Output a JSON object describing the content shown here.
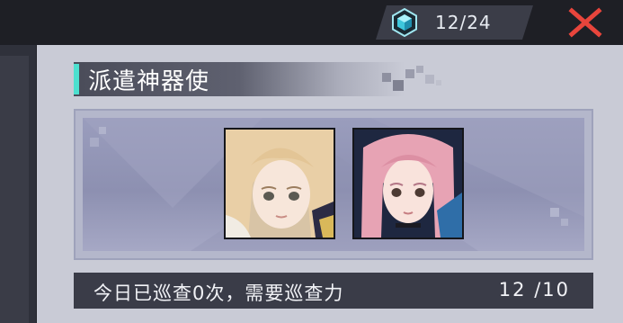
{
  "header": {
    "counter_text": "12/24",
    "counter_icon": "crystal-cube-icon",
    "close_icon": "close-icon",
    "close_color": "#e8453c"
  },
  "panel": {
    "title": "派遣神器使",
    "accent_color": "#4de0cf"
  },
  "characters": [
    {
      "name": "blonde-girl-portrait",
      "hair": "#e9cfa6"
    },
    {
      "name": "pink-hair-girl-portrait",
      "hair": "#e7a3b4"
    }
  ],
  "status": {
    "text": "今日已巡查0次，需要巡查力",
    "count": "12 /10"
  }
}
